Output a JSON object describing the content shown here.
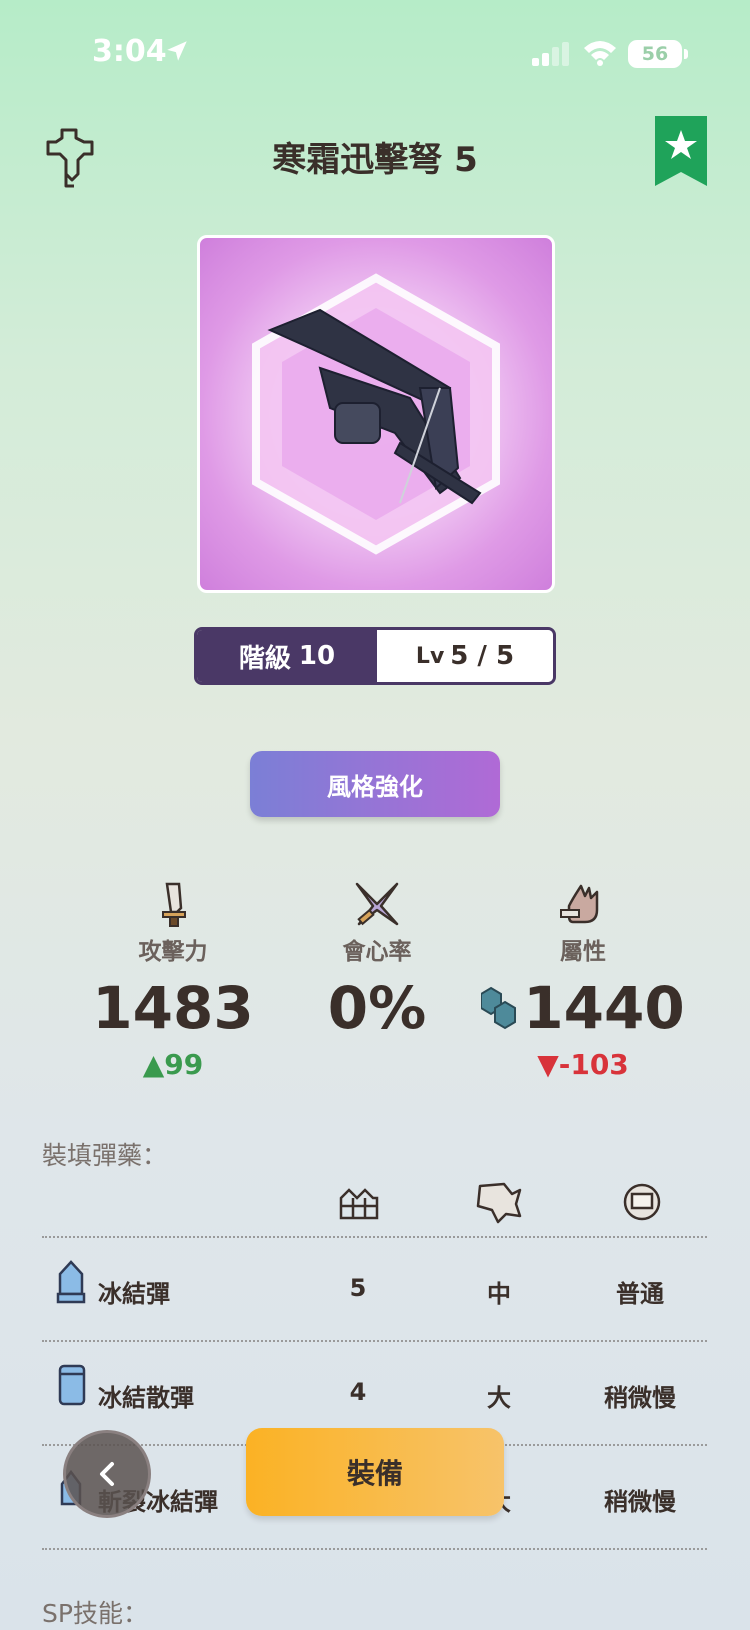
{
  "status_bar": {
    "time": "3:04",
    "battery": "56"
  },
  "header": {
    "title": "寒霜迅擊弩 5"
  },
  "rank": {
    "rank_label": "階級",
    "rank_value": "10",
    "lv_label": "Lv",
    "lv_value": "5 / 5"
  },
  "style_button": {
    "label": "風格強化"
  },
  "stats": {
    "attack": {
      "label": "攻擊力",
      "value": "1483",
      "delta": "▲99"
    },
    "critical": {
      "label": "會心率",
      "value": "0%"
    },
    "element": {
      "label": "屬性",
      "value": "1440",
      "delta": "▼-103"
    }
  },
  "ammo": {
    "section_label": "裝填彈藥：",
    "rows": [
      {
        "name": "冰結彈",
        "capacity": "5",
        "recoil": "中",
        "reload": "普通"
      },
      {
        "name": "冰結散彈",
        "capacity": "4",
        "recoil": "大",
        "reload": "稍微慢"
      },
      {
        "name": "斬裂冰結彈",
        "capacity": "",
        "recoil": "大",
        "reload": "稍微慢"
      }
    ]
  },
  "sp_skill": {
    "label": "SP技能："
  },
  "equip_button": {
    "label": "裝備"
  },
  "colors": {
    "accent_purple": "#4a3866",
    "fav_green": "#1fa35a",
    "equip_orange": "#fbb224",
    "up_green": "#3a9a4e",
    "down_red": "#d8333a"
  }
}
